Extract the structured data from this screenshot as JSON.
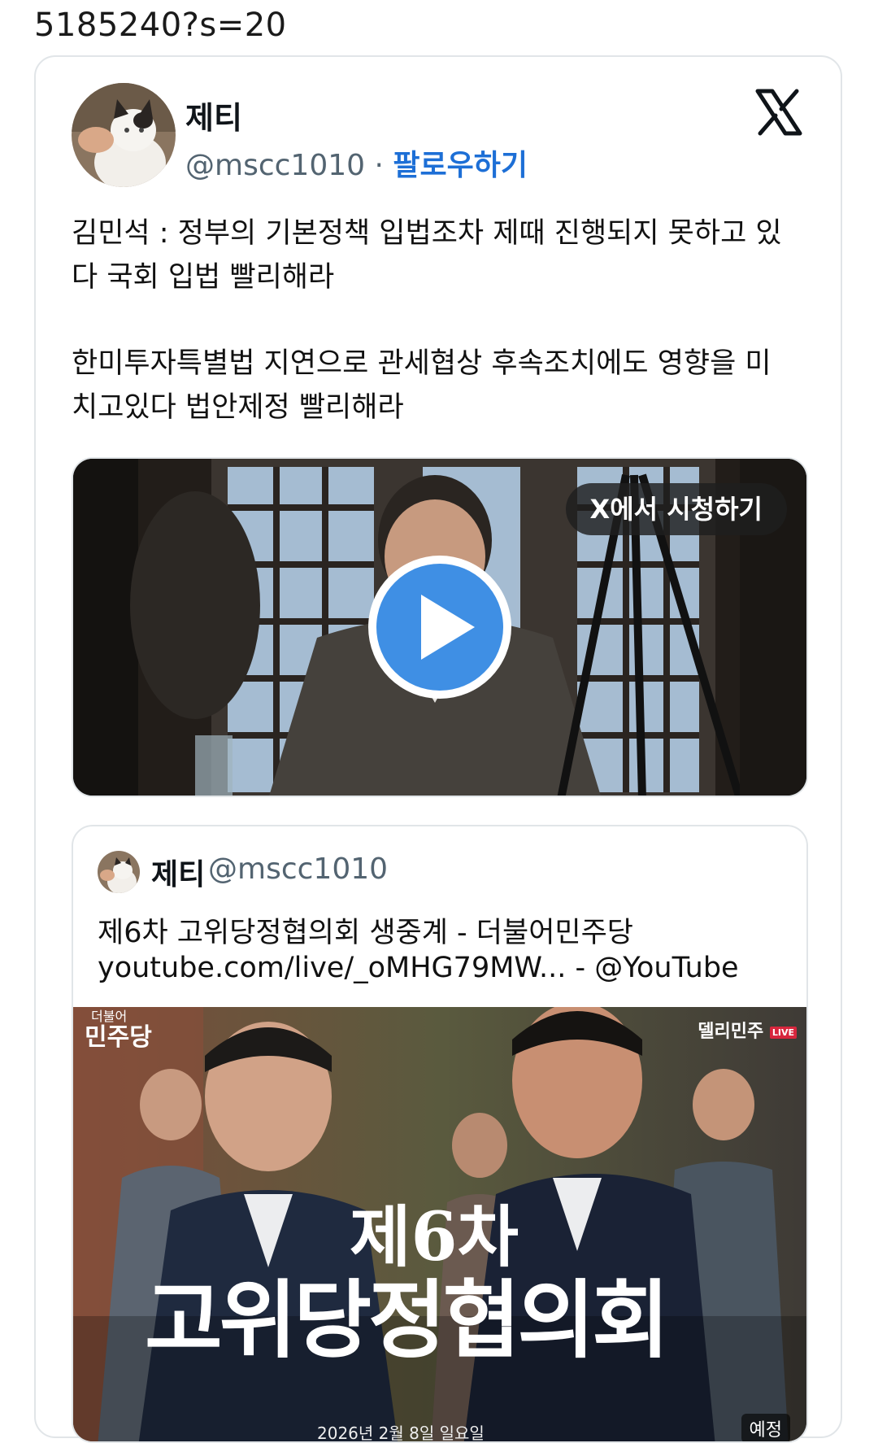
{
  "page": {
    "url_fragment": "5185240?s=20"
  },
  "tweet": {
    "display_name": "제티",
    "handle": "@mscc1010",
    "separator": "·",
    "follow_label": "팔로우하기",
    "paragraphs": [
      "김민석 : 정부의 기본정책 입법조차 제때 진행되지 못하고 있\n다 국회 입법 빨리해라",
      "한미투자특별법 지연으로 관세협상 후속조치에도 영향을 미\n치고있다 법안제정 빨리해라"
    ],
    "video": {
      "watch_label": "X에서 시청하기"
    }
  },
  "quote": {
    "display_name": "제티",
    "handle": "@mscc1010",
    "title_line": "제6차 고위당정협의회 생중계 - 더불어민주당",
    "link_line": "youtube.com/live/_oMHG79MW... - @YouTube",
    "thumbnail": {
      "brand_left": "민주당",
      "brand_left_small": "더불어",
      "brand_right": "델리민주",
      "live_badge": "LIVE",
      "title_small": "제6차",
      "title_big": "고위당정협의회",
      "date_text": "2026년 2월 8일 일요일",
      "badge_text": "예정"
    }
  },
  "colors": {
    "follow": "#1d6fd6",
    "play_button": "#3f8fe4",
    "border": "#e1e5e8"
  }
}
